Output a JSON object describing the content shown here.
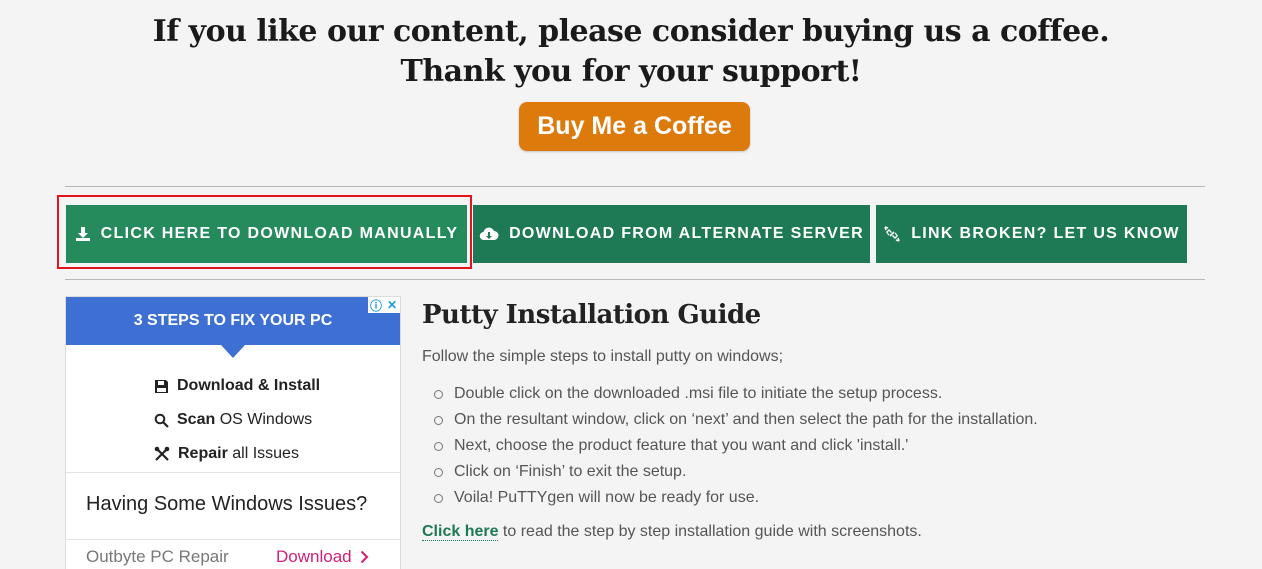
{
  "support": {
    "line1": "If you like our content, please consider buying us a coffee.",
    "line2": "Thank you for your support!",
    "coffee_button": "Buy Me a Coffee"
  },
  "downloads": {
    "manual": "CLICK HERE TO DOWNLOAD MANUALLY",
    "alternate": "DOWNLOAD FROM ALTERNATE SERVER",
    "broken": "LINK BROKEN? LET US KNOW"
  },
  "ad": {
    "heading": "3 STEPS TO FIX YOUR PC",
    "steps": [
      {
        "bold": "Download & Install",
        "rest": "",
        "icon": "floppy-icon"
      },
      {
        "bold": "Scan",
        "rest": " OS Windows",
        "icon": "magnifier-icon"
      },
      {
        "bold": "Repair",
        "rest": " all Issues",
        "icon": "tools-icon"
      }
    ],
    "title": "Having Some Windows Issues?",
    "brand": "Outbyte PC Repair",
    "download": "Download"
  },
  "guide": {
    "title": "Putty Installation Guide",
    "intro": "Follow the simple steps to install putty on windows;",
    "steps": [
      "Double click on the downloaded .msi file to initiate the setup process.",
      "On the resultant window, click on ‘next’ and then select the path for the installation.",
      "Next, choose the product feature that you want and click 'install.'",
      "Click on ‘Finish’ to exit the setup.",
      "Voila! PuTTYgen will now be ready for use."
    ],
    "footer_link": "Click here",
    "footer_text": " to read the step by step installation guide with screenshots."
  },
  "colors": {
    "coffee": "#dd7a0c",
    "green": "#1e7a54",
    "highlight": "#e3141c",
    "ad_blue": "#3e70d3",
    "ad_pink": "#d0207a"
  }
}
